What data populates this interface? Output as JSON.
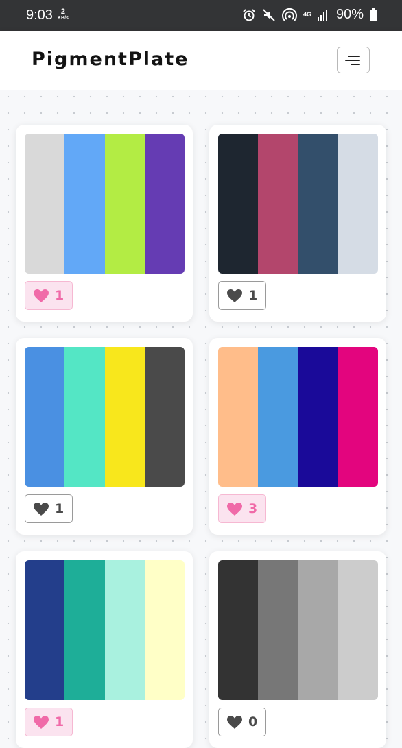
{
  "status_bar": {
    "time": "9:03",
    "speed_value": "2",
    "speed_unit": "KB/s",
    "network": "4G",
    "battery": "90%"
  },
  "header": {
    "brand": "PigmentPlate",
    "menu_icon": "hamburger-menu-icon"
  },
  "palettes": [
    {
      "colors": [
        "#d9d9d9",
        "#62a8f7",
        "#b3ec44",
        "#653cb3"
      ],
      "likes": "1",
      "liked": true
    },
    {
      "colors": [
        "#1e2630",
        "#b3466c",
        "#334f6b",
        "#d5dce5"
      ],
      "likes": "1",
      "liked": false
    },
    {
      "colors": [
        "#4a90e2",
        "#54e6c5",
        "#f8e71c",
        "#4a4a4a"
      ],
      "likes": "1",
      "liked": false
    },
    {
      "colors": [
        "#ffbd8a",
        "#4a9ae0",
        "#1a0a99",
        "#e3057e"
      ],
      "likes": "3",
      "liked": true
    },
    {
      "colors": [
        "#233e8b",
        "#1eae98",
        "#a9f1df",
        "#ffffc7"
      ],
      "likes": "1",
      "liked": true
    },
    {
      "colors": [
        "#333333",
        "#777777",
        "#a8a8a8",
        "#cccccc"
      ],
      "likes": "0",
      "liked": false
    }
  ],
  "colors": {
    "liked_heart": "#f06aa8",
    "unliked_heart": "#4a4a4a",
    "status_bar_bg": "#333436"
  }
}
